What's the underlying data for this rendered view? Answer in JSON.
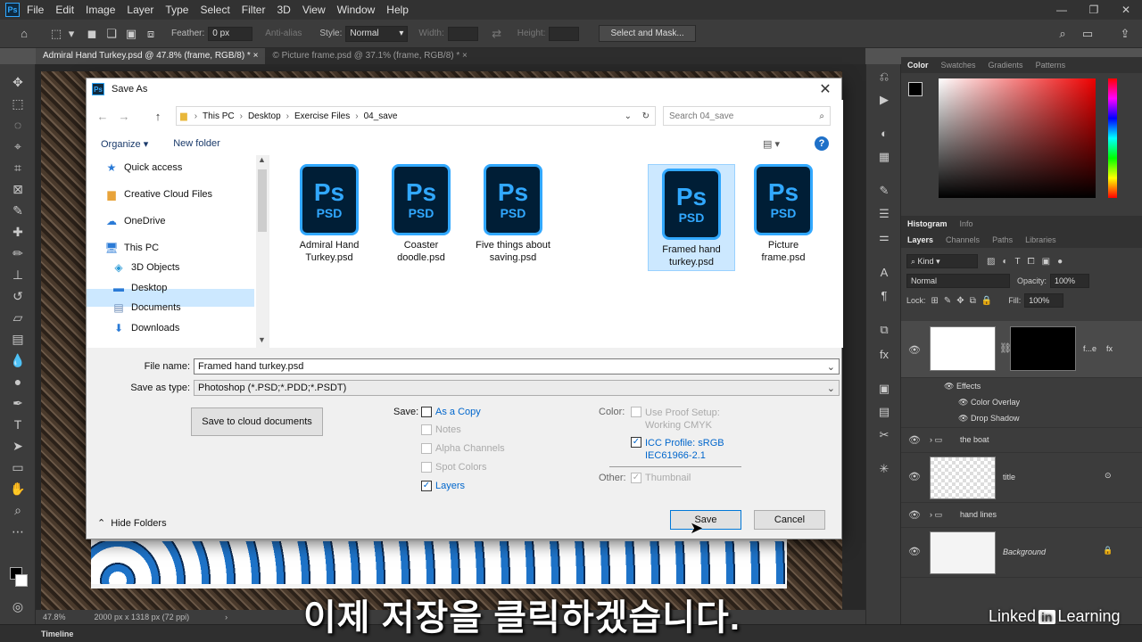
{
  "app": {
    "logo": "Ps",
    "menu": [
      "File",
      "Edit",
      "Image",
      "Layer",
      "Type",
      "Select",
      "Filter",
      "3D",
      "View",
      "Window",
      "Help"
    ]
  },
  "options": {
    "feather_label": "Feather:",
    "feather_value": "0 px",
    "anti_alias": "Anti-alias",
    "style_label": "Style:",
    "style_value": "Normal",
    "width_label": "Width:",
    "height_label": "Height:",
    "select_mask": "Select and Mask..."
  },
  "tabs": [
    {
      "label": "Admiral Hand Turkey.psd @ 47.8% (frame, RGB/8) *",
      "close": "×"
    },
    {
      "label": "© Picture frame.psd @ 37.1% (frame, RGB/8) *",
      "close": "×"
    }
  ],
  "status": {
    "zoom": "47.8%",
    "size": "2000 px x 1318 px (72 ppi)"
  },
  "timeline": "Timeline",
  "panel": {
    "color_tabs": [
      "Color",
      "Swatches",
      "Gradients",
      "Patterns"
    ],
    "hist_tabs": [
      "Histogram",
      "Info"
    ],
    "layer_tabs": [
      "Layers",
      "Channels",
      "Paths",
      "Libraries"
    ],
    "kind": "Kind",
    "blend": "Normal",
    "opacity_label": "Opacity:",
    "opacity": "100%",
    "lock_label": "Lock:",
    "fill_label": "Fill:",
    "fill": "100%",
    "layers": [
      {
        "name": "f...e"
      },
      {
        "name": "Effects"
      },
      {
        "name": "Color Overlay"
      },
      {
        "name": "Drop Shadow"
      },
      {
        "name": "the boat"
      },
      {
        "name": "title"
      },
      {
        "name": "hand lines"
      },
      {
        "name": "Background"
      }
    ]
  },
  "dialog": {
    "title": "Save As",
    "breadcrumb": [
      "This PC",
      "Desktop",
      "Exercise Files",
      "04_save"
    ],
    "search_placeholder": "Search 04_save",
    "organize": "Organize ▾",
    "new_folder": "New folder",
    "nav": [
      "Quick access",
      "Creative Cloud Files",
      "OneDrive",
      "This PC",
      "3D Objects",
      "Desktop",
      "Documents",
      "Downloads"
    ],
    "files": [
      {
        "name": "Admiral Hand Turkey.psd",
        "l1": "Admiral Hand",
        "l2": "Turkey.psd",
        "selected": false
      },
      {
        "name": "Coaster doodle.psd",
        "l1": "Coaster",
        "l2": "doodle.psd",
        "selected": false
      },
      {
        "name": "Five things about saving.psd",
        "l1": "Five things about",
        "l2": "saving.psd",
        "selected": false
      },
      {
        "name": "Framed hand turkey.psd",
        "l1": "Framed hand",
        "l2": "turkey.psd",
        "selected": true
      },
      {
        "name": "Picture frame.psd",
        "l1": "Picture",
        "l2": "frame.psd",
        "selected": false
      }
    ],
    "icon_ps": "Ps",
    "icon_psd": "PSD",
    "file_name_label": "File name:",
    "file_name": "Framed hand turkey.psd",
    "save_type_label": "Save as type:",
    "save_type": "Photoshop (*.PSD;*.PDD;*.PSDT)",
    "cloud_btn": "Save to cloud documents",
    "save_label": "Save:",
    "save_opts": [
      {
        "label": "As a Copy",
        "checked": false,
        "enabled": true
      },
      {
        "label": "Notes",
        "checked": false,
        "enabled": false
      },
      {
        "label": "Alpha Channels",
        "checked": false,
        "enabled": false
      },
      {
        "label": "Spot Colors",
        "checked": false,
        "enabled": false
      },
      {
        "label": "Layers",
        "checked": true,
        "enabled": true
      }
    ],
    "color_label": "Color:",
    "proof_l1": "Use Proof Setup:",
    "proof_l2": "Working CMYK",
    "icc_l1": "ICC Profile:  sRGB",
    "icc_l2": "IEC61966-2.1",
    "other_label": "Other:",
    "thumbnail": "Thumbnail",
    "hide_folders": "Hide Folders",
    "save_btn": "Save",
    "cancel_btn": "Cancel"
  },
  "subtitle": "이제 저장을 클릭하겠습니다.",
  "watermark": {
    "a": "Linked",
    "b": "in",
    "c": "Learning"
  }
}
